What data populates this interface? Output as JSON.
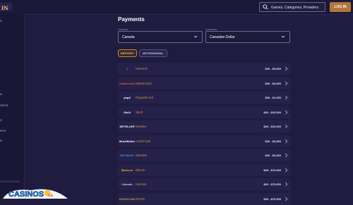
{
  "header": {
    "logo_text": "IN",
    "search_placeholder": "Games, Categories, Providers",
    "login_label": "LOG IN"
  },
  "sidebar": {
    "items": [
      "S",
      "G",
      "ORTS",
      "S",
      "NTS",
      "S"
    ]
  },
  "payments": {
    "title": "Payments",
    "country_label": "Country",
    "country_value": "Canada",
    "currency_label": "Currency",
    "currency_value": "Canadian Dollar",
    "tabs": [
      {
        "label": "DEPOSIT",
        "active": true
      },
      {
        "label": "WITHDRAWAL",
        "active": false
      }
    ],
    "methods": [
      {
        "logo": "I",
        "name": "Interac®",
        "limit": "$30 - $3,000",
        "color": "#f0a21a"
      },
      {
        "logo": "mastercard",
        "name": "Mastercard",
        "limit": "$30 - $4,000",
        "color": "#eb5a2a"
      },
      {
        "logo": "pspd",
        "name": "Paysafecard",
        "limit": "$30 - $1,000",
        "color": "#ffffff"
      },
      {
        "logo": "Skrill",
        "name": "Skrill",
        "limit": "$30 - $10,000",
        "color": "#ffffff"
      },
      {
        "logo": "NETELLER",
        "name": "Neteller",
        "limit": "$30 - $10,000",
        "color": "#ffffff"
      },
      {
        "logo": "MuchBetter",
        "name": "CashCode",
        "limit": "$30 - $4,500",
        "color": "#ffffff"
      },
      {
        "logo": "NETBANK",
        "name": "iWDebit",
        "limit": "$30 - $3,000",
        "color": "#3c8cd8"
      },
      {
        "logo": "₿bitcoin",
        "name": "Bitcoin",
        "limit": "$35 - $70,000",
        "color": "#f2a33a"
      },
      {
        "logo": "Litecoin",
        "name": "Litecoin",
        "limit": "$30 - $70,000",
        "color": "#d9d9e6"
      },
      {
        "logo": "DOGECOIN",
        "name": "DOGE",
        "limit": "$30 - $70,000",
        "color": "#c9a23a"
      }
    ]
  },
  "watermark": {
    "text": "CASINOS",
    "suffix": "ca"
  },
  "colors": {
    "accent": "#b0773a",
    "background": "#1f1c3f",
    "row": "#25214a",
    "method_name": "#d09546"
  }
}
